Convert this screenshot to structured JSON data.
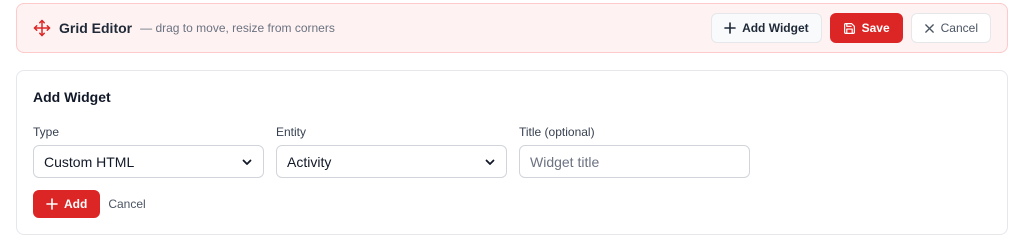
{
  "toolbar": {
    "title": "Grid Editor",
    "hint": "— drag to move, resize from corners",
    "add_widget_label": "Add Widget",
    "save_label": "Save",
    "cancel_label": "Cancel",
    "accent_color": "#dc2626"
  },
  "form": {
    "heading": "Add Widget",
    "type_label": "Type",
    "type_value": "Custom HTML",
    "entity_label": "Entity",
    "entity_value": "Activity",
    "title_label": "Title (optional)",
    "title_placeholder": "Widget title",
    "add_label": "Add",
    "cancel_label": "Cancel"
  }
}
